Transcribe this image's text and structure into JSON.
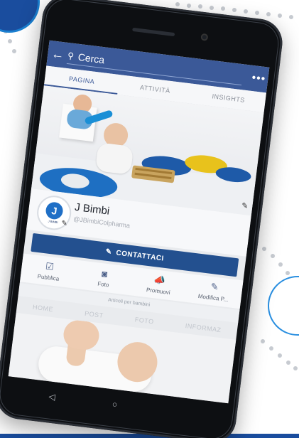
{
  "header": {
    "search_placeholder": "Cerca",
    "back_icon": "arrow-left-icon",
    "more_icon": "more-icon",
    "back_glyph": "←",
    "more_glyph": "•••",
    "search_glyph": "⚲"
  },
  "tabs": [
    {
      "label": "PAGINA",
      "active": true
    },
    {
      "label": "ATTIVITÀ",
      "active": false
    },
    {
      "label": "INSIGHTS",
      "active": false
    }
  ],
  "profile": {
    "name": "J Bimbi",
    "handle": "@JBimbiColpharma",
    "avatar_letter": "J",
    "avatar_logo_text": "J BIMBI"
  },
  "contact_button": {
    "label": "CONTATTACI",
    "icon_glyph": "✎"
  },
  "actions": [
    {
      "label": "Pubblica",
      "icon": "compose-icon",
      "glyph": "☑"
    },
    {
      "label": "Foto",
      "icon": "camera-icon",
      "glyph": "◙"
    },
    {
      "label": "Promuovi",
      "icon": "megaphone-icon",
      "glyph": "📣"
    },
    {
      "label": "Modifica P...",
      "icon": "pencil-icon",
      "glyph": "✎"
    }
  ],
  "subtitle": "Articoli per bambini",
  "page_nav": [
    "HOME",
    "POST",
    "FOTO",
    "INFORMAZ"
  ],
  "system_nav": {
    "glyph_back": "◁",
    "glyph_home": "○"
  },
  "colors": {
    "facebook_blue": "#3b5998",
    "contact_button": "#23508f",
    "brand_blue": "#1a4d9e"
  }
}
